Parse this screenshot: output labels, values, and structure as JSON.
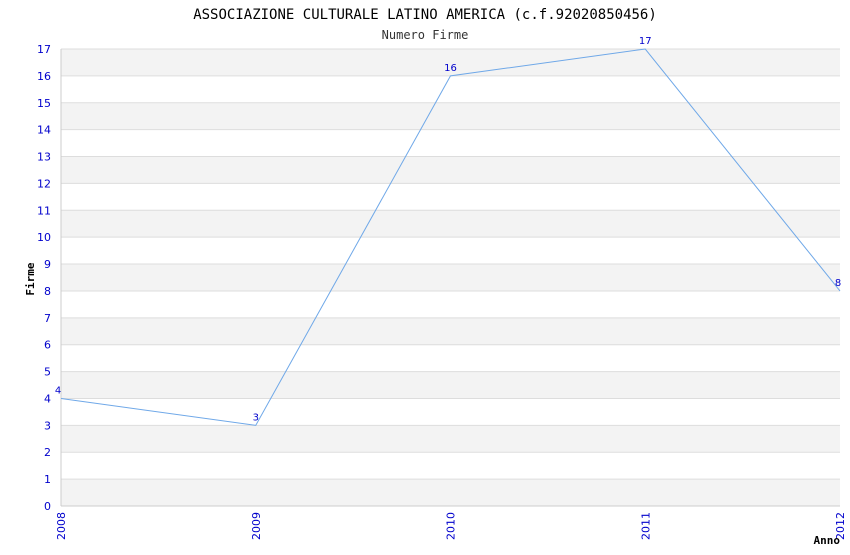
{
  "chart_data": {
    "type": "line",
    "title": "ASSOCIAZIONE CULTURALE LATINO AMERICA (c.f.92020850456)",
    "subtitle": "Numero Firme",
    "xlabel": "Anno",
    "ylabel": "Firme",
    "x": [
      "2008",
      "2009",
      "2010",
      "2011",
      "2012"
    ],
    "values": [
      4,
      3,
      16,
      17,
      8
    ],
    "data_labels": [
      "4",
      "3",
      "16",
      "17",
      "8"
    ],
    "ylim": [
      0,
      17
    ],
    "yticks": [
      "0",
      "1",
      "2",
      "3",
      "4",
      "5",
      "6",
      "7",
      "8",
      "9",
      "10",
      "11",
      "12",
      "13",
      "14",
      "15",
      "16",
      "17"
    ],
    "grid": true,
    "legend": "none",
    "colors": {
      "line": "#6fa8e8",
      "tick_text": "#0000cc",
      "band": "#f3f3f3",
      "grid": "#dddddd",
      "axis": "#cccccc"
    }
  }
}
